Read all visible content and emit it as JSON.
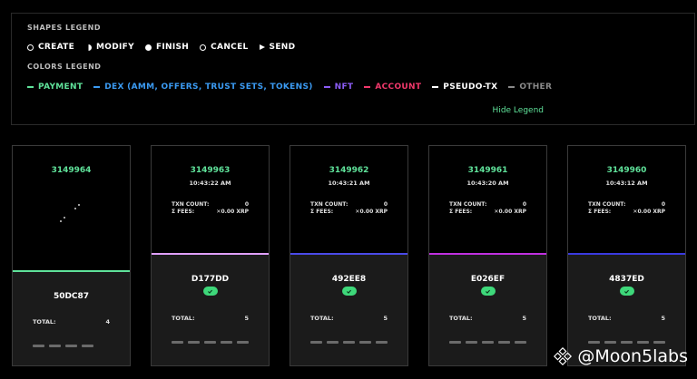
{
  "legend": {
    "shapes_heading": "SHAPES LEGEND",
    "shapes": [
      {
        "label": "CREATE",
        "icon": "circle-outline-icon"
      },
      {
        "label": "MODIFY",
        "icon": "half-circle-icon"
      },
      {
        "label": "FINISH",
        "icon": "filled-circle-icon"
      },
      {
        "label": "CANCEL",
        "icon": "circle-outline-icon"
      },
      {
        "label": "SEND",
        "icon": "play-triangle-icon"
      }
    ],
    "colors_heading": "COLORS LEGEND",
    "colors": [
      {
        "label": "PAYMENT",
        "color": "#5fe29a"
      },
      {
        "label": "DEX (AMM, OFFERS, TRUST SETS, TOKENS)",
        "color": "#3b9bf3"
      },
      {
        "label": "NFT",
        "color": "#8b5cf6"
      },
      {
        "label": "ACCOUNT",
        "color": "#f0386b"
      },
      {
        "label": "PSEUDO-TX",
        "color": "#ffffff"
      },
      {
        "label": "OTHER",
        "color": "#8a8a8a"
      }
    ],
    "hide_label": "Hide Legend"
  },
  "ledgers": [
    {
      "index": "3149964",
      "time": "",
      "txn_label": "",
      "txn_count": "",
      "fees_label": "",
      "fees": "",
      "hash": "50DC87",
      "total_label": "TOTAL:",
      "total": "4",
      "bar_color": "#5fe29a",
      "bars": 4,
      "pending": true
    },
    {
      "index": "3149963",
      "time": "10:43:22 AM",
      "txn_label": "TXN COUNT:",
      "txn_count": "0",
      "fees_label": "Σ FEES:",
      "fees": "0.00 XRP",
      "hash": "D177DD",
      "total_label": "TOTAL:",
      "total": "5",
      "bar_color": "#e0a0ff",
      "bars": 5,
      "pending": false
    },
    {
      "index": "3149962",
      "time": "10:43:21 AM",
      "txn_label": "TXN COUNT:",
      "txn_count": "0",
      "fees_label": "Σ FEES:",
      "fees": "0.00 XRP",
      "hash": "492EE8",
      "total_label": "TOTAL:",
      "total": "5",
      "bar_color": "#4a4ae8",
      "bars": 5,
      "pending": false
    },
    {
      "index": "3149961",
      "time": "10:43:20 AM",
      "txn_label": "TXN COUNT:",
      "txn_count": "0",
      "fees_label": "Σ FEES:",
      "fees": "0.00 XRP",
      "hash": "E026EF",
      "total_label": "TOTAL:",
      "total": "5",
      "bar_color": "#c030e0",
      "bars": 5,
      "pending": false
    },
    {
      "index": "3149960",
      "time": "10:43:12 AM",
      "txn_label": "TXN COUNT:",
      "txn_count": "0",
      "fees_label": "Σ FEES:",
      "fees": "0.00 XRP",
      "hash": "4837ED",
      "total_label": "TOTAL:",
      "total": "5",
      "bar_color": "#3a3ae0",
      "bars": 5,
      "pending": false
    }
  ],
  "watermark": {
    "text": "@Moon5labs",
    "icon": "binance-logo-icon"
  }
}
